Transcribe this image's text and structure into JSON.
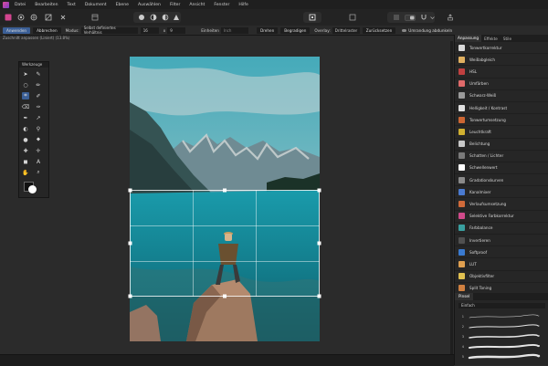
{
  "menu": [
    "Datei",
    "Bearbeiten",
    "Text",
    "Dokument",
    "Ebene",
    "Auswählen",
    "Filter",
    "Ansicht",
    "Fenster",
    "Hilfe"
  ],
  "context": {
    "apply": "Anwenden",
    "cancel": "Abbrechen",
    "mode_label": "Modus:",
    "mode_value": "Selbst definiertes Verhältnis",
    "ratio_a": "16",
    "ratio_x": "x",
    "ratio_b": "9",
    "unit_label": "Einheiten",
    "unit_value": "Inch",
    "rotate": "Drehen",
    "straighten": "Begradigen",
    "overlay_label": "Overlay:",
    "overlay_value": "Drittelraster",
    "reset": "Zurücksetzen",
    "hide_outside": "Umrandung abdunkeln"
  },
  "status": "Zuschnitt anpassen (Liniert) (13.8%)",
  "tools_title": "Werkzeuge",
  "right_panel": {
    "tabs": [
      "Anpassung",
      "Effekte",
      "Stile"
    ],
    "adjustments": [
      {
        "label": "Tonwertkorrektur",
        "color": "#d9d9d9"
      },
      {
        "label": "Weißabgleich",
        "color": "#e0b060"
      },
      {
        "label": "HSL",
        "color": "#c04040"
      },
      {
        "label": "Umfärben",
        "color": "#e06a6a"
      },
      {
        "label": "Schwarz-Weiß",
        "color": "#9a9a9a"
      },
      {
        "label": "Helligkeit / Kontrast",
        "color": "#e0e0e0"
      },
      {
        "label": "Tonwertumsetzung",
        "color": "#cc6633"
      },
      {
        "label": "Leuchtkraft",
        "color": "#d0b030"
      },
      {
        "label": "Belichtung",
        "color": "#c8c8c8"
      },
      {
        "label": "Schatten / Lichter",
        "color": "#7a7a7a"
      },
      {
        "label": "Schwellenwert",
        "color": "#ffffff"
      },
      {
        "label": "Gradationskurven",
        "color": "#8a8a8a"
      },
      {
        "label": "Kanalmixer",
        "color": "#4a7ad0"
      },
      {
        "label": "Verlaufsumsetzung",
        "color": "#d06a3a"
      },
      {
        "label": "Selektive Farbkorrektur",
        "color": "#d04a8a"
      },
      {
        "label": "Farbbalance",
        "color": "#3aa0a0"
      },
      {
        "label": "Invertieren",
        "color": "#505050"
      },
      {
        "label": "Softproof",
        "color": "#3a7ad0"
      },
      {
        "label": "LUT",
        "color": "#e0a050"
      },
      {
        "label": "Objektivfilter",
        "color": "#e0c050"
      },
      {
        "label": "Split Toning",
        "color": "#d08040"
      },
      {
        "label": "OCIO",
        "color": "#b0b0b0"
      }
    ],
    "brush_tab": "Pinsel",
    "brush_category": "Einfach",
    "brush_sizes": [
      "1",
      "2",
      "3",
      "4",
      "5"
    ]
  }
}
